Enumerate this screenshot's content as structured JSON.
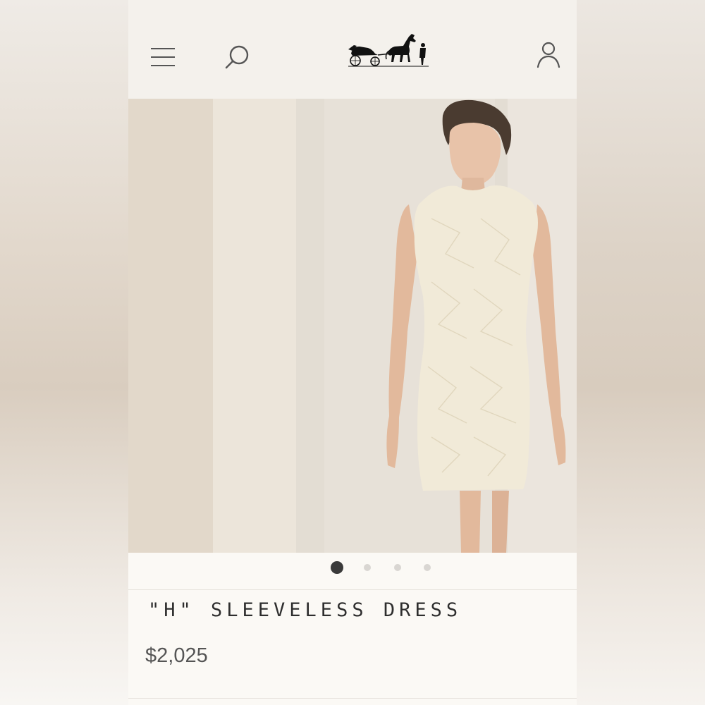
{
  "header": {
    "menu_icon": "hamburger-menu-icon",
    "search_icon": "search-icon",
    "logo": "carriage-logo",
    "account_icon": "account-icon"
  },
  "carousel": {
    "total_slides": 4,
    "active_slide": 1
  },
  "product": {
    "title": "\"H\" SLEEVELESS DRESS",
    "price": "$2,025"
  },
  "colors": {
    "page_background": "#fbf9f5",
    "header_background": "#f4f1ec",
    "text_dark": "#2e2e2e",
    "dot_active": "#3a3a3a",
    "dot_inactive": "#d9d6d2"
  }
}
